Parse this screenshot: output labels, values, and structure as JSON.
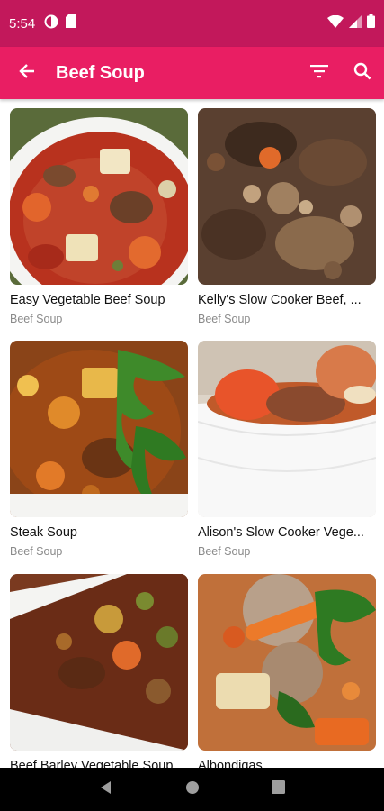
{
  "status": {
    "time": "5:54"
  },
  "app_bar": {
    "title": "Beef Soup"
  },
  "recipes": [
    {
      "title": "Easy Vegetable Beef Soup",
      "category": "Beef Soup"
    },
    {
      "title": "Kelly's Slow Cooker Beef, ...",
      "category": "Beef Soup"
    },
    {
      "title": "Steak Soup",
      "category": "Beef Soup"
    },
    {
      "title": "Alison's Slow Cooker Vege...",
      "category": "Beef Soup"
    },
    {
      "title": "Beef Barley Vegetable Soup",
      "category": ""
    },
    {
      "title": "Albondigas",
      "category": ""
    }
  ],
  "colors": {
    "status_bar": "#c2185b",
    "app_bar": "#e91e63"
  }
}
